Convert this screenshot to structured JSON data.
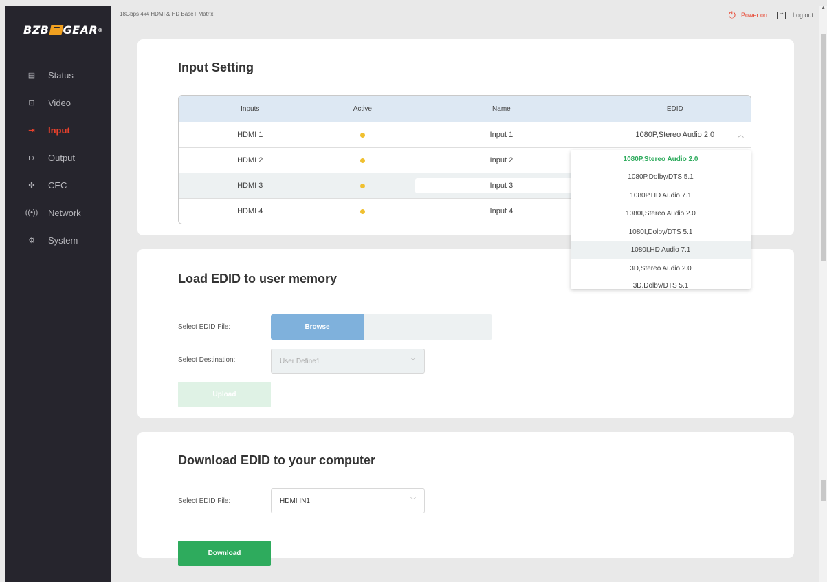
{
  "brand": {
    "logo_left": "BZB",
    "logo_right": "GEAR",
    "logo_tm": "®"
  },
  "header": {
    "device_title": "18Gbps 4x4 HDMI & HD BaseT Matrix",
    "power_label": "Power on",
    "logout_label": "Log out"
  },
  "sidebar": {
    "items": [
      {
        "label": "Status",
        "icon": "status-icon"
      },
      {
        "label": "Video",
        "icon": "video-icon"
      },
      {
        "label": "Input",
        "icon": "input-icon",
        "active": true
      },
      {
        "label": "Output",
        "icon": "output-icon"
      },
      {
        "label": "CEC",
        "icon": "cec-icon"
      },
      {
        "label": "Network",
        "icon": "network-icon"
      },
      {
        "label": "System",
        "icon": "system-icon"
      }
    ]
  },
  "input_setting": {
    "title": "Input Setting",
    "columns": [
      "Inputs",
      "Active",
      "Name",
      "EDID"
    ],
    "rows": [
      {
        "input": "HDMI 1",
        "name": "Input 1",
        "edid": "1080P,Stereo Audio 2.0"
      },
      {
        "input": "HDMI 2",
        "name": "Input 2"
      },
      {
        "input": "HDMI 3",
        "name": "Input 3"
      },
      {
        "input": "HDMI 4",
        "name": "Input 4"
      }
    ],
    "edid_options": [
      "1080P,Stereo Audio 2.0",
      "1080P,Dolby/DTS 5.1",
      "1080P,HD Audio 7.1",
      "1080I,Stereo Audio 2.0",
      "1080I,Dolby/DTS 5.1",
      "1080I,HD Audio 7.1",
      "3D,Stereo Audio 2.0",
      "3D,Dolby/DTS 5.1"
    ]
  },
  "load_edid": {
    "title": "Load EDID to user memory",
    "file_label": "Select EDID File:",
    "browse_label": "Browse",
    "destination_label": "Select Destination:",
    "destination_value": "User Define1",
    "upload_label": "Upload"
  },
  "download_edid": {
    "title": "Download EDID to your computer",
    "file_label": "Select EDID File:",
    "file_value": "HDMI IN1",
    "download_label": "Download"
  },
  "colors": {
    "accent_red": "#e8412c",
    "success_green": "#2eab5d",
    "active_dot": "#f0c030",
    "browse_blue": "#7fb1dc"
  }
}
